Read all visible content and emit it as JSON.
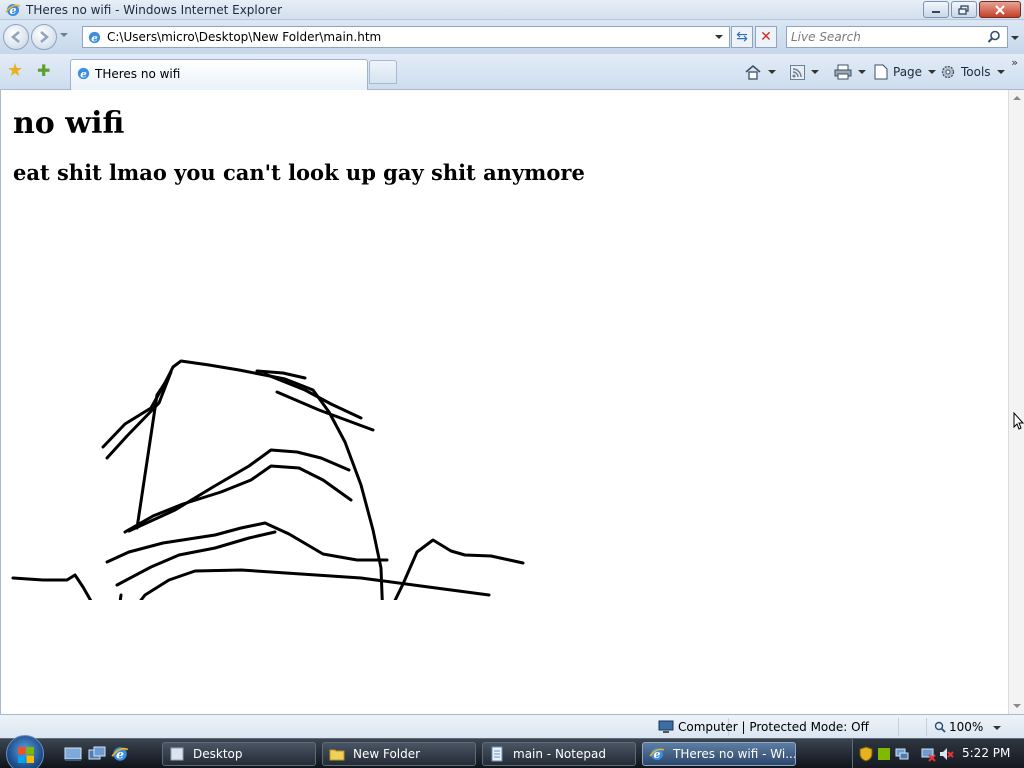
{
  "window": {
    "title": "THeres no wifi - Windows Internet Explorer"
  },
  "nav": {
    "url": "C:\\Users\\micro\\Desktop\\New Folder\\main.htm",
    "search_placeholder": "Live Search"
  },
  "tabs": [
    {
      "label": "THeres no wifi"
    }
  ],
  "command_bar": {
    "page_label": "Page",
    "tools_label": "Tools"
  },
  "page": {
    "heading": "no wifi",
    "subheading": "eat shit lmao you can't look up gay shit anymore"
  },
  "status": {
    "zone": "Computer | Protected Mode: Off",
    "zoom": "100%"
  },
  "taskbar": {
    "items": [
      {
        "label": "Desktop"
      },
      {
        "label": "New Folder"
      },
      {
        "label": "main - Notepad"
      },
      {
        "label": "THeres no wifi - Wi..."
      }
    ],
    "clock": "5:22 PM"
  },
  "colors": {
    "accent": "#2f6fb5",
    "ink": "#000000"
  }
}
